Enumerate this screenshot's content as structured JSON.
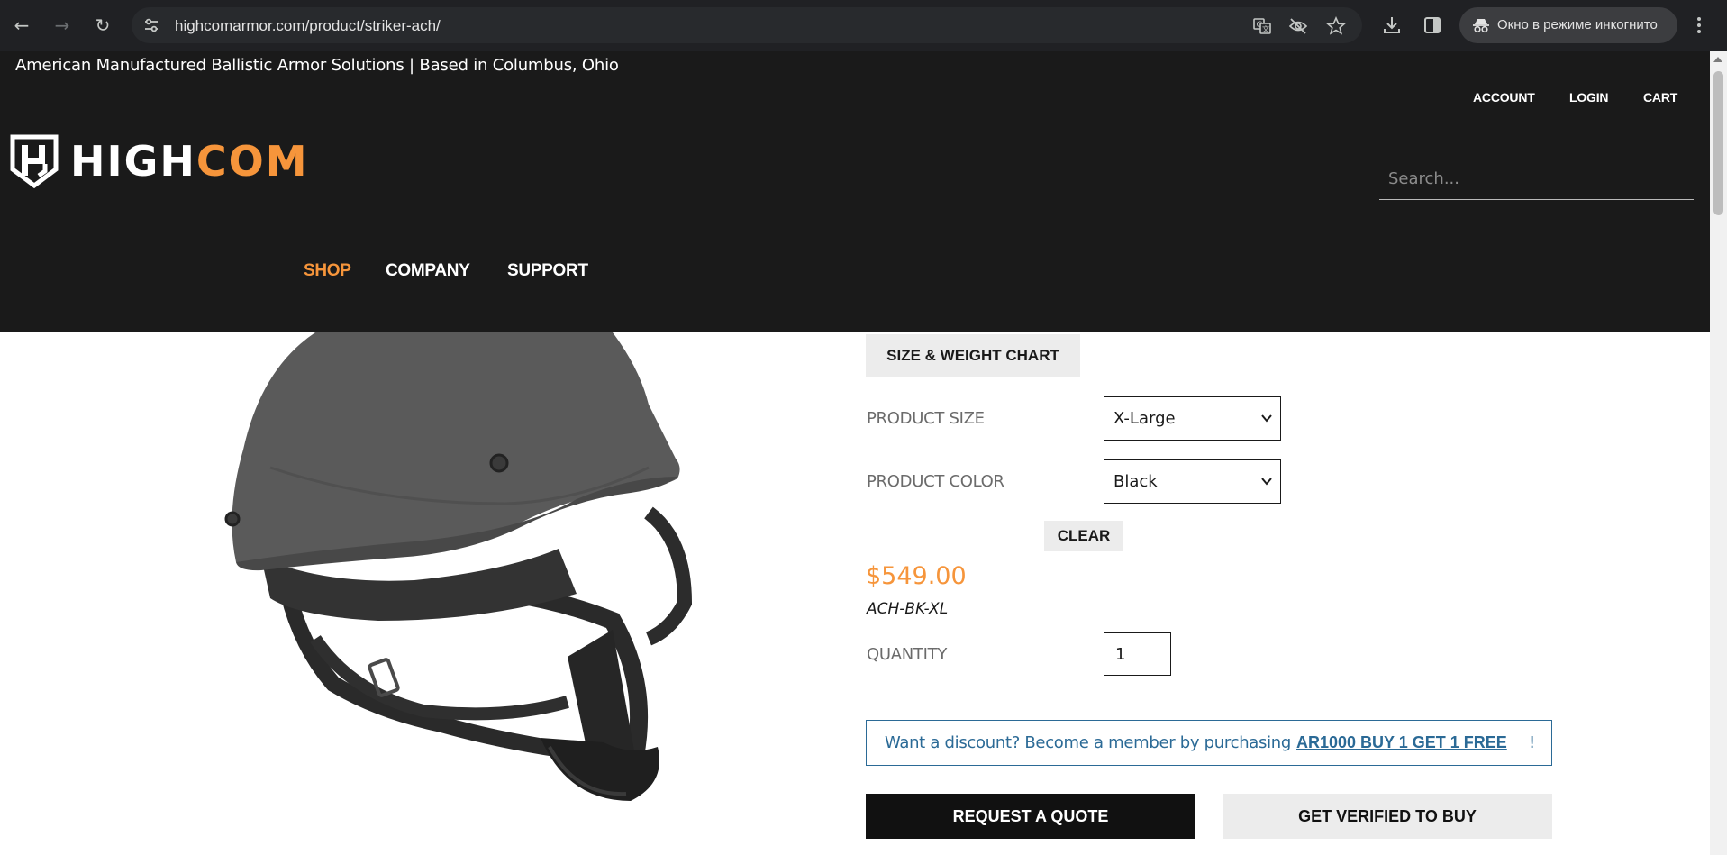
{
  "browser": {
    "url_host": "highcomarmor.com",
    "url_path": "/product/striker-ach/",
    "incognito_label": "Окно в режиме инкогнито"
  },
  "header": {
    "tagline": "American Manufactured Ballistic Armor Solutions | Based in Columbus, Ohio",
    "util_nav": [
      "ACCOUNT",
      "LOGIN",
      "CART"
    ],
    "logo_part1": "HIGH",
    "logo_part2": "COM",
    "search_placeholder": "Search...",
    "main_nav": [
      "SHOP",
      "COMPANY",
      "SUPPORT"
    ],
    "active_nav": "SHOP"
  },
  "product": {
    "size_chart_label": "SIZE & WEIGHT CHART",
    "size_label": "PRODUCT SIZE",
    "size_value": "X-Large",
    "color_label": "PRODUCT COLOR",
    "color_value": "Black",
    "clear_label": "CLEAR",
    "price": "$549.00",
    "sku": "ACH-BK-XL",
    "quantity_label": "QUANTITY",
    "quantity_value": "1",
    "discount_text": "Want a discount? Become a member by purchasing",
    "discount_link": "AR1000 BUY 1 GET 1 FREE",
    "discount_suffix": "!",
    "request_quote_label": "REQUEST A QUOTE",
    "verify_label": "GET VERIFIED TO BUY"
  },
  "colors": {
    "accent": "#f6953b",
    "header_bg": "#1a1a1a",
    "link": "#2b6a96"
  }
}
